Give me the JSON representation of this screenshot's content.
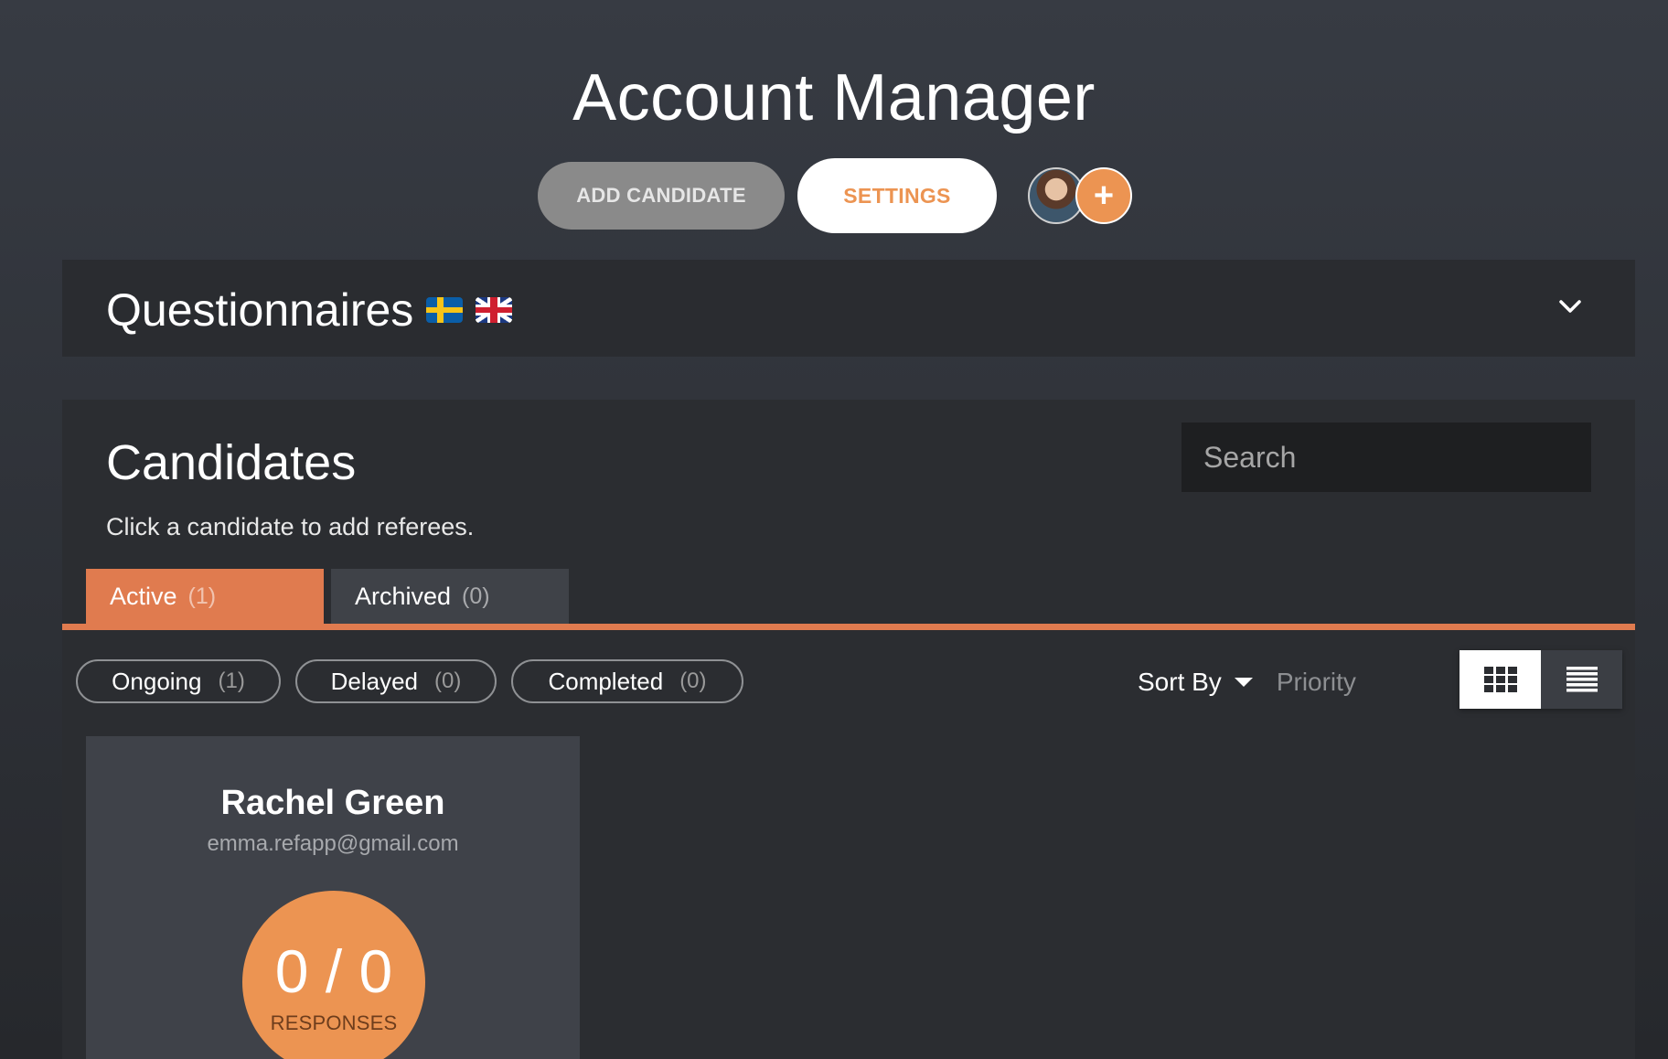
{
  "header": {
    "title": "Account Manager",
    "add_candidate_label": "ADD CANDIDATE",
    "settings_label": "SETTINGS",
    "add_user_symbol": "+"
  },
  "questionnaires": {
    "title": "Questionnaires",
    "flags": [
      "sweden-flag",
      "uk-flag"
    ],
    "toggle_icon": "chevron-down-icon"
  },
  "candidates": {
    "title": "Candidates",
    "subtitle": "Click a candidate to add referees.",
    "search_placeholder": "Search",
    "tabs": [
      {
        "label": "Active",
        "count": "(1)",
        "selected": true
      },
      {
        "label": "Archived",
        "count": "(0)",
        "selected": false
      }
    ],
    "filters": [
      {
        "label": "Ongoing",
        "count": "(1)"
      },
      {
        "label": "Delayed",
        "count": "(0)"
      },
      {
        "label": "Completed",
        "count": "(0)"
      }
    ],
    "sort": {
      "label": "Sort By",
      "value": "Priority"
    },
    "view_modes": [
      "grid-view-icon",
      "list-view-icon"
    ],
    "selected_view": "grid",
    "cards": [
      {
        "name": "Rachel Green",
        "email": "emma.refapp@gmail.com",
        "responses_value": "0 / 0",
        "responses_label": "RESPONSES"
      }
    ]
  },
  "colors": {
    "background": "#33363c",
    "panel": "#2a2c30",
    "accent_orange": "#ec9452",
    "tab_orange": "#e07b4f",
    "button_gray": "#8a8a8a"
  }
}
